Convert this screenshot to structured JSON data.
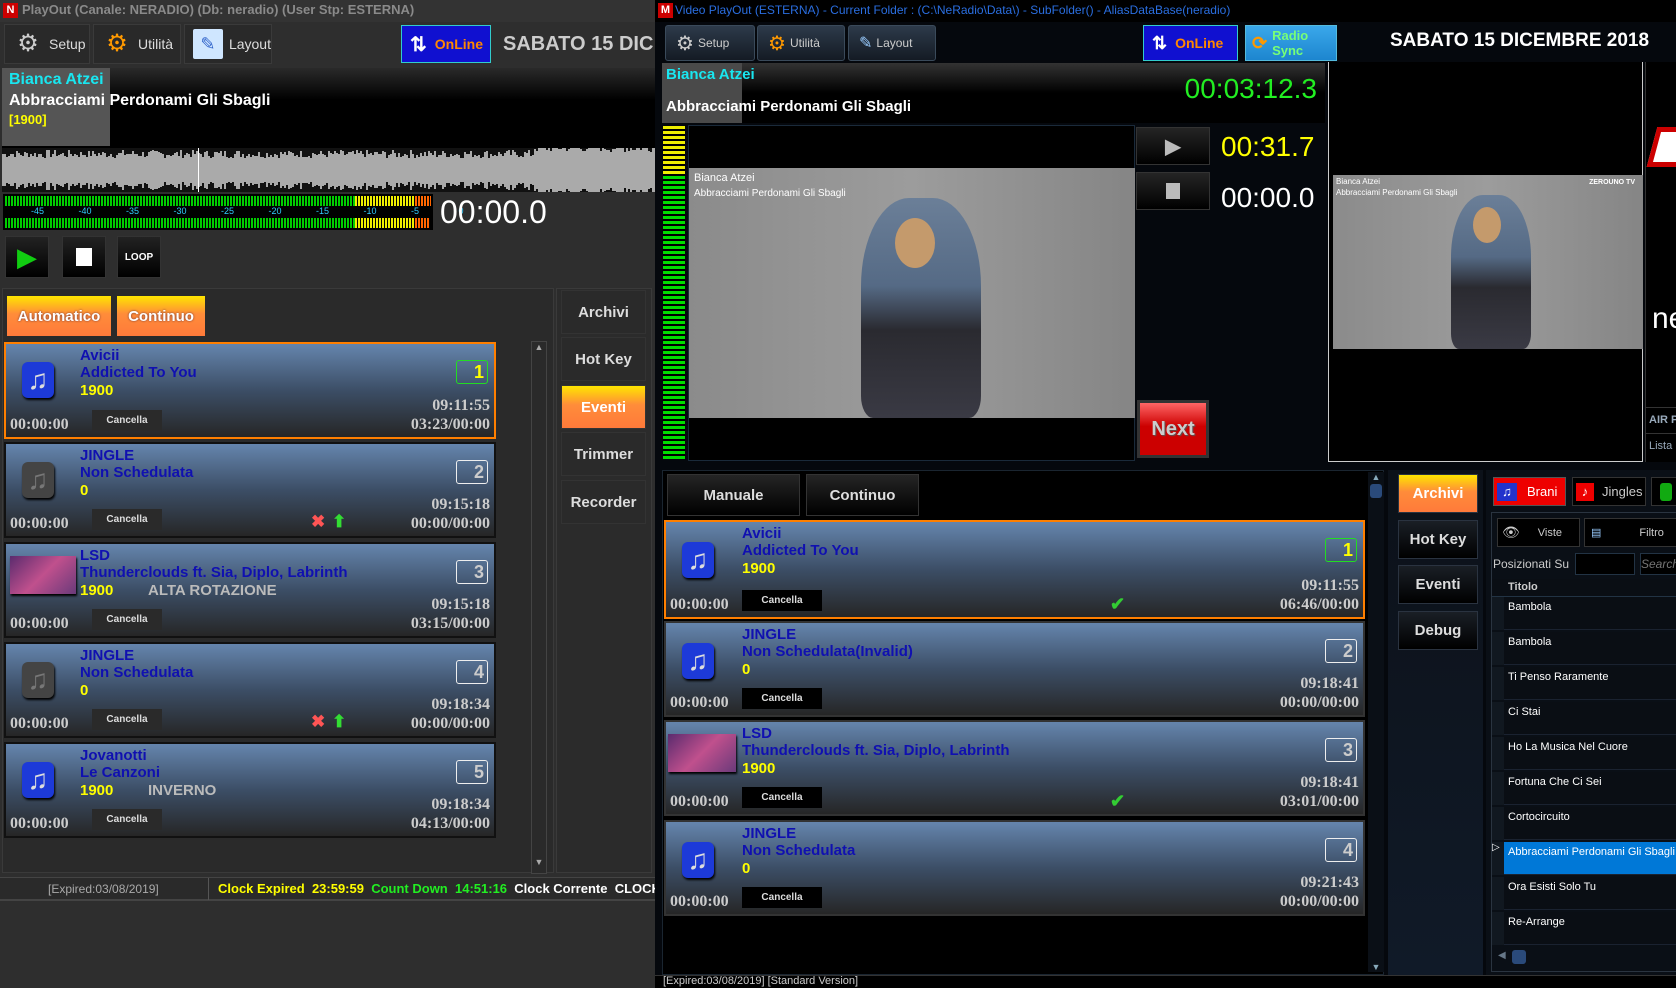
{
  "left": {
    "title": "PlayOut (Canale: NERADIO) (Db: neradio) (User Stp: ESTERNA)",
    "toolbar": {
      "setup": "Setup",
      "utilita": "Utilità",
      "layout": "Layout",
      "online": "OnLine",
      "date": "SABATO   15 DIC"
    },
    "now_playing": {
      "artist": "Bianca Atzei",
      "title": "Abbracciami Perdonami Gli Sbagli",
      "year": "[1900]",
      "time": "00:00.0"
    },
    "vu_scale": [
      "-45",
      "-40",
      "-35",
      "-30",
      "-25",
      "-20",
      "-15",
      "-10",
      "-5",
      "0"
    ],
    "transport": {
      "loop": "LOOP"
    },
    "modes": {
      "automatico": "Automatico",
      "continuo": "Continuo"
    },
    "nav": [
      "Archivi",
      "Hot Key",
      "Eventi",
      "Trimmer",
      "Recorder"
    ],
    "nav_active": 2,
    "playlist": [
      {
        "artist": "Avicii",
        "title": "Addicted To You",
        "year": "1900",
        "category": "",
        "start": "00:00:00",
        "cancel": "Cancella",
        "num": "1",
        "time": "09:11:55",
        "dur": "03:23/00:00",
        "art": "music",
        "selected": true,
        "actions": false
      },
      {
        "artist": "JINGLE",
        "title": "Non Schedulata",
        "year": "0",
        "category": "",
        "start": "00:00:00",
        "cancel": "Cancella",
        "num": "2",
        "time": "09:15:18",
        "dur": "00:00/00:00",
        "art": "music-grey",
        "selected": false,
        "actions": true
      },
      {
        "artist": "LSD",
        "title": "Thunderclouds ft. Sia, Diplo, Labrinth",
        "year": "1900",
        "category": "ALTA ROTAZIONE",
        "start": "00:00:00",
        "cancel": "Cancella",
        "num": "3",
        "time": "09:15:18",
        "dur": "03:15/00:00",
        "art": "cover",
        "selected": false,
        "actions": false
      },
      {
        "artist": "JINGLE",
        "title": "Non Schedulata",
        "year": "0",
        "category": "",
        "start": "00:00:00",
        "cancel": "Cancella",
        "num": "4",
        "time": "09:18:34",
        "dur": "00:00/00:00",
        "art": "music-grey",
        "selected": false,
        "actions": true
      },
      {
        "artist": "Jovanotti",
        "title": "Le Canzoni",
        "year": "1900",
        "category": "INVERNO",
        "start": "00:00:00",
        "cancel": "Cancella",
        "num": "5",
        "time": "09:18:34",
        "dur": "04:13/00:00",
        "art": "music",
        "selected": false,
        "actions": false
      }
    ],
    "status": {
      "expired": "[Expired:03/08/2019]",
      "clock_expired_label": "Clock Expired",
      "clock_expired": "23:59:59",
      "countdown_label": "Count Down",
      "countdown": "14:51:16",
      "clock_corrente_label": "Clock Corrente",
      "clock": "CLOCK"
    }
  },
  "right": {
    "title": "Video PlayOut (ESTERNA) - Current Folder : (C:\\NeRadio\\Data\\) - SubFolder() - AliasDataBase(neradio)",
    "toolbar": {
      "setup": "Setup",
      "utilita": "Utilità",
      "layout": "Layout",
      "online": "OnLine",
      "radio_sync": "Radio Sync",
      "date": "SABATO  15 DICEMBRE  2018"
    },
    "now_playing": {
      "artist": "Bianca Atzei",
      "title": "Abbracciami Perdonami Gli Sbagli",
      "elapsed": "00:03:12.3",
      "remaining": "00:31.7",
      "cue": "00:00.0"
    },
    "video_overlay": {
      "artist": "Bianca Atzei",
      "title": "Abbracciami Perdonami Gli Sbagli"
    },
    "preview_overlay": {
      "artist": "Bianca Atzei",
      "title": "Abbracciami Perdonami Gli Sbagli",
      "brand": "ZEROUNO TV"
    },
    "next": "Next",
    "side_panel": {
      "air": "AIR P",
      "lista": "Lista"
    },
    "modes": {
      "manuale": "Manuale",
      "continuo": "Continuo"
    },
    "nav": [
      "Archivi",
      "Hot Key",
      "Eventi",
      "Debug"
    ],
    "nav_active": 0,
    "playlist": [
      {
        "artist": "Avicii",
        "title": "Addicted To You",
        "year": "1900",
        "start": "00:00:00",
        "cancel": "Cancella",
        "num": "1",
        "time": "09:11:55",
        "dur": "06:46/00:00",
        "art": "music",
        "selected": true,
        "check": true
      },
      {
        "artist": "JINGLE",
        "title": "Non Schedulata(Invalid)",
        "year": "0",
        "start": "00:00:00",
        "cancel": "Cancella",
        "num": "2",
        "time": "09:18:41",
        "dur": "00:00/00:00",
        "art": "music",
        "selected": false,
        "check": false
      },
      {
        "artist": "LSD",
        "title": "Thunderclouds ft. Sia, Diplo, Labrinth",
        "year": "1900",
        "start": "00:00:00",
        "cancel": "Cancella",
        "num": "3",
        "time": "09:18:41",
        "dur": "03:01/00:00",
        "art": "cover",
        "selected": false,
        "check": true
      },
      {
        "artist": "JINGLE",
        "title": "Non Schedulata",
        "year": "0",
        "start": "00:00:00",
        "cancel": "Cancella",
        "num": "4",
        "time": "09:21:43",
        "dur": "00:00/00:00",
        "art": "music",
        "selected": false,
        "check": false
      }
    ],
    "library": {
      "tabs": {
        "brani": "Brani",
        "jingles": "Jingles"
      },
      "viste": "Viste",
      "filtro": "Filtro",
      "posizionati": "Posizionati Su",
      "search_placeholder": "Search",
      "column": "Titolo",
      "rows": [
        "Bambola",
        "Bambola",
        "Ti Penso Raramente",
        "Ci Stai",
        "Ho La Musica Nel Cuore",
        "Fortuna Che Ci Sei",
        "Cortocircuito",
        "Abbracciami Perdonami Gli Sbagli",
        "Ora Esisti Solo Tu",
        "Re-Arrange"
      ],
      "selected_index": 7
    },
    "status": "[Expired:03/08/2019] [Standard Version]"
  }
}
